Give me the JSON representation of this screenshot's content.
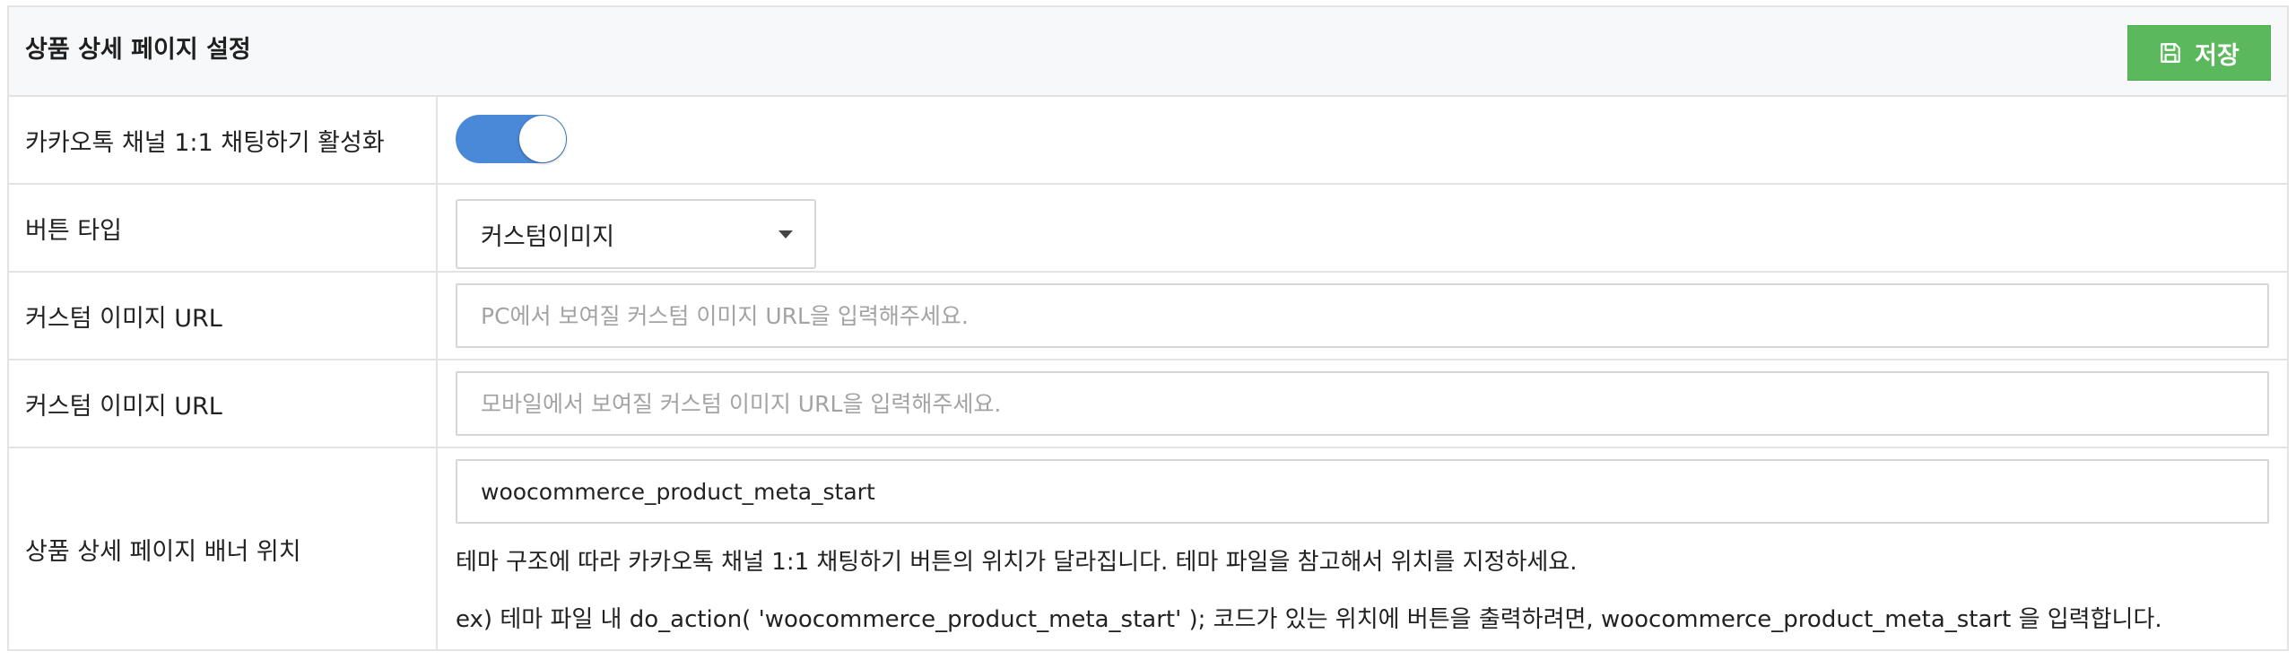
{
  "header": {
    "title": "상품 상세 페이지 설정",
    "save_label": "저장",
    "save_icon": "floppy-disk-icon"
  },
  "rows": {
    "kakao_enable": {
      "label": "카카오톡 채널 1:1 채팅하기 활성화",
      "toggle_on": true
    },
    "button_type": {
      "label": "버튼 타입",
      "selected": "커스텀이미지"
    },
    "custom_image_pc": {
      "label": "커스텀 이미지 URL",
      "value": "",
      "placeholder": "PC에서 보여질 커스텀 이미지 URL을 입력해주세요."
    },
    "custom_image_mobile": {
      "label": "커스텀 이미지 URL",
      "value": "",
      "placeholder": "모바일에서 보여질 커스텀 이미지 URL을 입력해주세요."
    },
    "banner_position": {
      "label": "상품 상세 페이지 배너 위치",
      "value": "woocommerce_product_meta_start",
      "help_1": "테마 구조에 따라 카카오톡 채널 1:1 채팅하기 버튼의 위치가 달라집니다. 테마 파일을 참고해서 위치를 지정하세요.",
      "help_2": "ex) 테마 파일 내 do_action( 'woocommerce_product_meta_start' ); 코드가 있는 위치에 버튼을 출력하려면, woocommerce_product_meta_start 을 입력합니다."
    }
  },
  "colors": {
    "save_button": "#5cb85c",
    "toggle_on": "#4a89d8"
  }
}
